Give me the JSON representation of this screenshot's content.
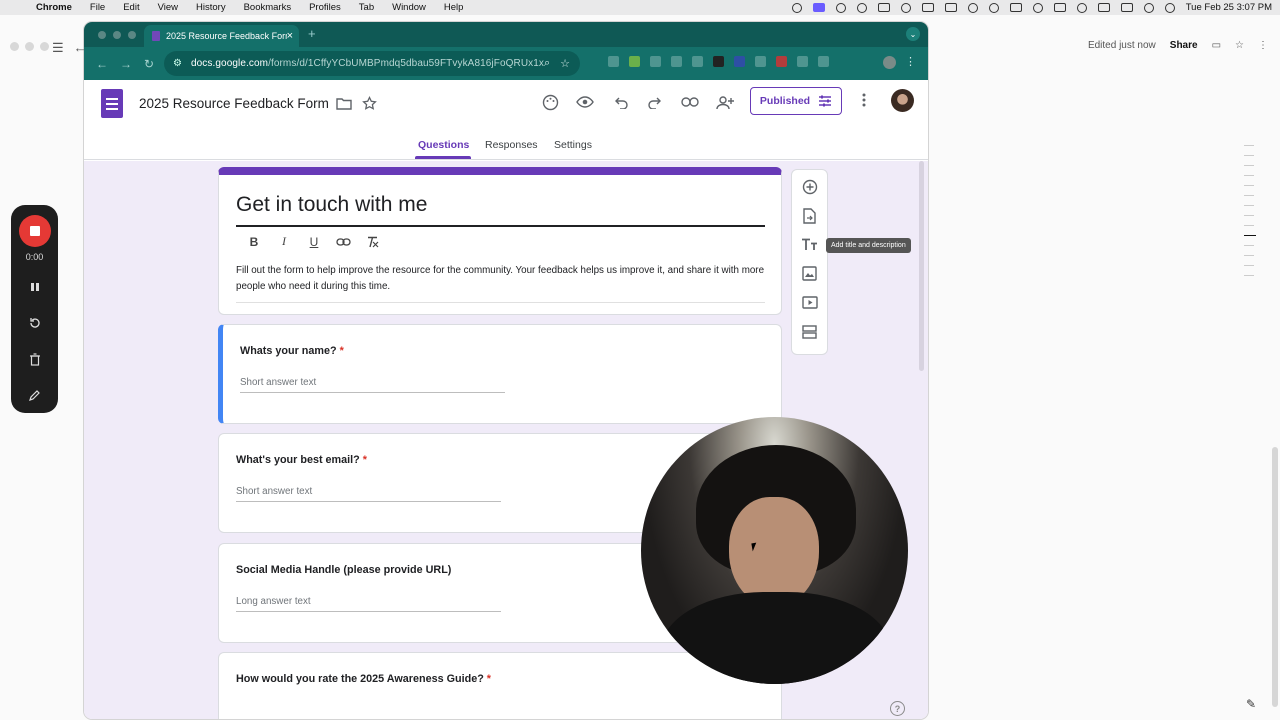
{
  "menubar": {
    "app": "Chrome",
    "items": [
      "File",
      "Edit",
      "View",
      "History",
      "Bookmarks",
      "Profiles",
      "Tab",
      "Window",
      "Help"
    ],
    "datetime": "Tue Feb 25  3:07 PM"
  },
  "background_doc": {
    "status": "Edited just now",
    "share": "Share"
  },
  "recorder": {
    "time": "0:00"
  },
  "browser": {
    "tab_title": "2025 Resource Feedback Form",
    "url_host": "docs.google.com",
    "url_path": "/forms/d/1CffyYCbUMBPmdq5dbau59FTvykA816jFoQRUx1xLd..."
  },
  "form": {
    "doc_title": "2025 Resource Feedback Form",
    "publish_label": "Published",
    "tabs": [
      "Questions",
      "Responses",
      "Settings"
    ],
    "heading": "Get in touch with me",
    "description": "Fill out the form to help improve the resource for the community. Your feedback helps us improve it, and share it with more people who need it during this time.",
    "tooltip": "Add title and description",
    "questions": [
      {
        "title": "Whats your name?",
        "required": "*",
        "placeholder": "Short answer text"
      },
      {
        "title": "What's your best email?",
        "required": "*",
        "placeholder": "Short answer text"
      },
      {
        "title": "Social Media Handle (please provide URL)",
        "required": "",
        "placeholder": "Long answer text"
      },
      {
        "title": "How would you rate the 2025 Awareness Guide?",
        "required": "*",
        "placeholder": ""
      }
    ]
  },
  "colors": {
    "accent": "#673ab7",
    "tab_strip": "#0f5955",
    "toolbar": "#14706a",
    "canvas": "#f0ebf8",
    "active_question": "#4285f4"
  }
}
